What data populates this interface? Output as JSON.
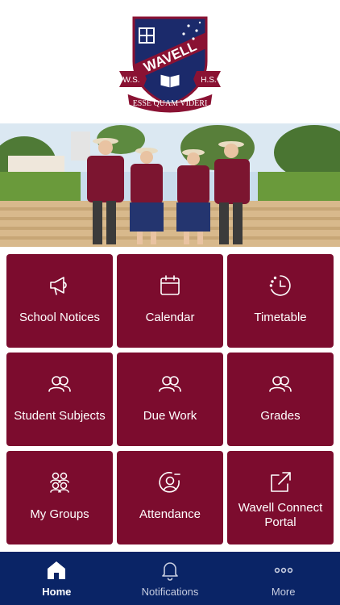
{
  "logo": {
    "name": "WAVELL",
    "left_initials": "W.S.",
    "right_initials": "H.S.",
    "motto": "ESSE QUAM VIDERI"
  },
  "colors": {
    "tile": "#7c0c2e",
    "tabbar": "#0a2466",
    "navy": "#1b2a6b",
    "maroon": "#8a1233"
  },
  "tiles": [
    {
      "label": "School Notices",
      "icon": "megaphone-icon"
    },
    {
      "label": "Calendar",
      "icon": "calendar-icon"
    },
    {
      "label": "Timetable",
      "icon": "clock-icon"
    },
    {
      "label": "Student Subjects",
      "icon": "users-icon"
    },
    {
      "label": "Due Work",
      "icon": "users-icon"
    },
    {
      "label": "Grades",
      "icon": "users-icon"
    },
    {
      "label": "My Groups",
      "icon": "group-icon"
    },
    {
      "label": "Attendance",
      "icon": "user-circle-icon"
    },
    {
      "label": "Wavell Connect Portal",
      "icon": "external-link-icon"
    }
  ],
  "tabs": [
    {
      "label": "Home",
      "icon": "home-icon",
      "active": true
    },
    {
      "label": "Notifications",
      "icon": "bell-icon",
      "active": false
    },
    {
      "label": "More",
      "icon": "more-icon",
      "active": false
    }
  ]
}
